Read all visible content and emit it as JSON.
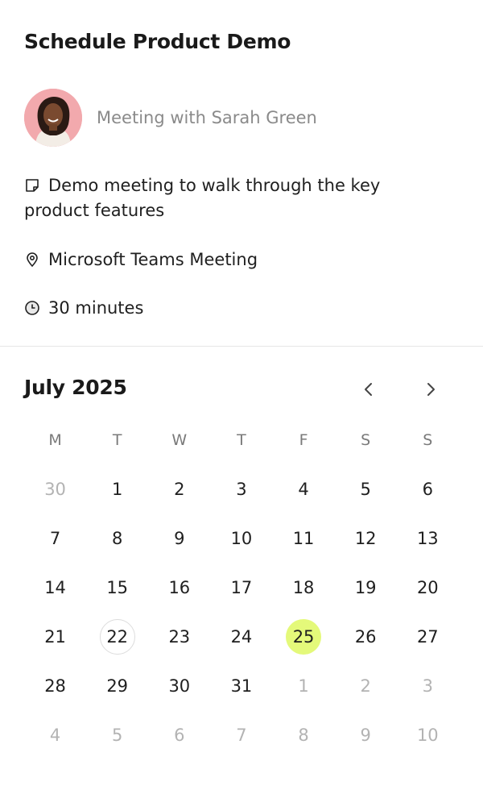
{
  "title": "Schedule Product Demo",
  "host": {
    "text": "Meeting with Sarah Green"
  },
  "details": {
    "description": "Demo meeting to walk through the key product features",
    "location": "Microsoft Teams Meeting",
    "duration": "30 minutes"
  },
  "calendar": {
    "month_label": "July 2025",
    "weekdays": [
      "M",
      "T",
      "W",
      "T",
      "F",
      "S",
      "S"
    ],
    "weeks": [
      [
        {
          "d": "30",
          "muted": true
        },
        {
          "d": "1"
        },
        {
          "d": "2"
        },
        {
          "d": "3"
        },
        {
          "d": "4"
        },
        {
          "d": "5"
        },
        {
          "d": "6"
        }
      ],
      [
        {
          "d": "7"
        },
        {
          "d": "8"
        },
        {
          "d": "9"
        },
        {
          "d": "10"
        },
        {
          "d": "11"
        },
        {
          "d": "12"
        },
        {
          "d": "13"
        }
      ],
      [
        {
          "d": "14"
        },
        {
          "d": "15"
        },
        {
          "d": "16"
        },
        {
          "d": "17"
        },
        {
          "d": "18"
        },
        {
          "d": "19"
        },
        {
          "d": "20"
        }
      ],
      [
        {
          "d": "21"
        },
        {
          "d": "22",
          "today": true
        },
        {
          "d": "23"
        },
        {
          "d": "24"
        },
        {
          "d": "25",
          "selected": true
        },
        {
          "d": "26"
        },
        {
          "d": "27"
        }
      ],
      [
        {
          "d": "28"
        },
        {
          "d": "29"
        },
        {
          "d": "30"
        },
        {
          "d": "31"
        },
        {
          "d": "1",
          "muted": true
        },
        {
          "d": "2",
          "muted": true
        },
        {
          "d": "3",
          "muted": true
        }
      ],
      [
        {
          "d": "4",
          "muted": true
        },
        {
          "d": "5",
          "muted": true
        },
        {
          "d": "6",
          "muted": true
        },
        {
          "d": "7",
          "muted": true
        },
        {
          "d": "8",
          "muted": true
        },
        {
          "d": "9",
          "muted": true
        },
        {
          "d": "10",
          "muted": true
        }
      ]
    ],
    "selected_color": "#e4f97a"
  },
  "icons": {
    "description": "note-icon",
    "location": "map-pin-icon",
    "duration": "clock-icon",
    "prev": "chevron-left-icon",
    "next": "chevron-right-icon"
  }
}
